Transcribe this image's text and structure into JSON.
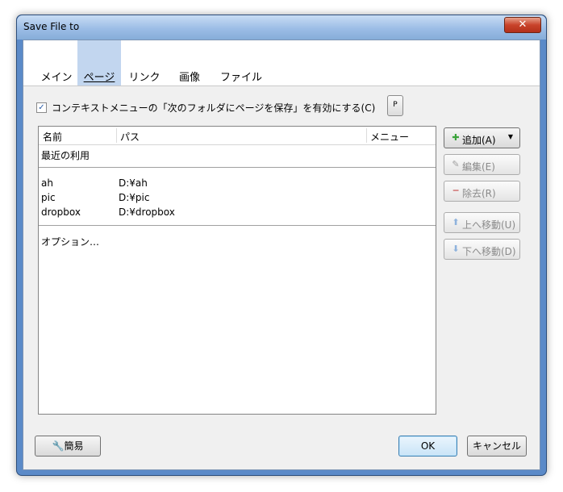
{
  "window": {
    "title": "Save File to",
    "close_label": "✕"
  },
  "tabs": [
    {
      "label": "メイン"
    },
    {
      "label": "ページ",
      "active": true
    },
    {
      "label": "リンク"
    },
    {
      "label": "画像"
    },
    {
      "label": "ファイル"
    }
  ],
  "options": {
    "context_menu_checkbox_label": "コンテキストメニューの「次のフォルダにページを保存」を有効にする(C)",
    "context_menu_checked": true,
    "p_button_label": "P"
  },
  "list": {
    "columns": [
      "名前",
      "パス",
      "メニュー"
    ],
    "recent_label": "最近の利用",
    "rows": [
      {
        "name": "ah",
        "path": "D:¥ah"
      },
      {
        "name": "pic",
        "path": "D:¥pic"
      },
      {
        "name": "dropbox",
        "path": "D:¥dropbox"
      }
    ],
    "options_label": "オプション…"
  },
  "side_buttons": {
    "add": "追加(A)",
    "edit": "編集(E)",
    "remove": "除去(R)",
    "move_up": "上へ移動(U)",
    "move_down": "下へ移動(D)"
  },
  "bottom": {
    "simple_label": "簡易",
    "ok_label": "OK",
    "cancel_label": "キャンセル"
  },
  "colors": {
    "accent": "#5b8ac8",
    "active_tab": "#c2d6ef"
  }
}
